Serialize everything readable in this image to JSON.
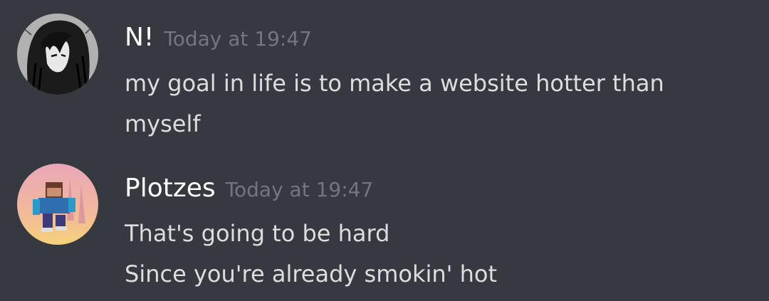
{
  "messages": [
    {
      "username": "N!",
      "timestamp": "Today at 19:47",
      "avatar_icon": "anime-girl-avatar",
      "lines": [
        "my goal in life is to make a website hotter than",
        "myself"
      ]
    },
    {
      "username": "Plotzes",
      "timestamp": "Today at 19:47",
      "avatar_icon": "minecraft-skin-avatar",
      "avatar_text": "Plotzes",
      "lines": [
        "That's going to be hard",
        "Since you're already smokin' hot"
      ]
    }
  ],
  "colors": {
    "background": "#36393f",
    "username": "#ffffff",
    "timestamp": "#72767d",
    "message_text": "#dcddde"
  }
}
